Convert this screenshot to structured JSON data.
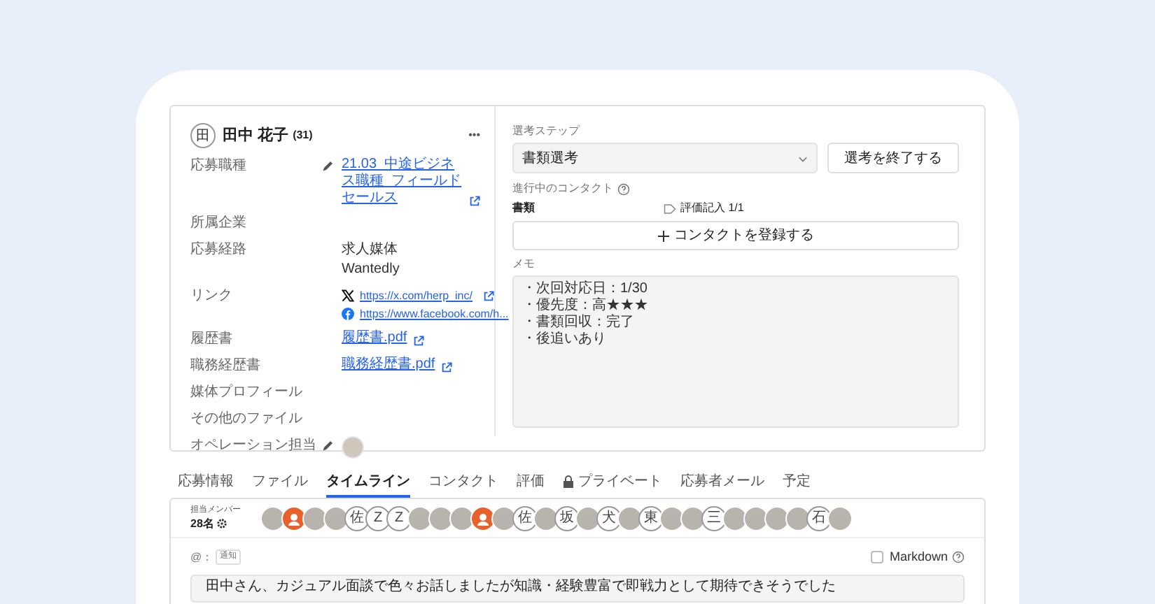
{
  "candidate": {
    "initial": "田",
    "name": "田中 花子",
    "age": "(31)",
    "more": "•••"
  },
  "fields": [
    {
      "label": "応募職種",
      "editable": true,
      "kind": "links",
      "values": [
        "21.03_中途ビジネス職種_フィールドセールス"
      ]
    },
    {
      "label": "所属企業",
      "editable": false,
      "kind": "text"
    },
    {
      "label": "応募経路",
      "editable": false,
      "kind": "text",
      "values": [
        "求人媒体",
        "Wantedly"
      ]
    },
    {
      "label": "リンク",
      "editable": false,
      "kind": "social",
      "values": [
        "https://x.com/herp_inc/",
        "https://www.facebook.com/h..."
      ]
    },
    {
      "label": "履歴書",
      "editable": false,
      "kind": "links",
      "values": [
        "履歴書.pdf"
      ]
    },
    {
      "label": "職務経歴書",
      "editable": false,
      "kind": "links",
      "values": [
        "職務経歴書.pdf"
      ]
    },
    {
      "label": "媒体プロフィール",
      "editable": false,
      "kind": "text"
    },
    {
      "label": "その他のファイル",
      "editable": false,
      "kind": "text"
    },
    {
      "label": "オペレーション担当",
      "editable": true,
      "kind": "avatar"
    }
  ],
  "step": {
    "label": "選考ステップ",
    "value": "書類選考",
    "end_button": "選考を終了する"
  },
  "contacts": {
    "label": "進行中のコンタクト",
    "name": "書類",
    "evaluation": "評価記入 1/1",
    "add_button": "コンタクトを登録する"
  },
  "memo": {
    "label": "メモ",
    "lines": [
      "・次回対応日：1/30",
      "・優先度：高★★★",
      "・書類回収：完了",
      "・後追いあり"
    ]
  },
  "tabs": [
    {
      "label": "応募情報",
      "selected": false,
      "locked": false
    },
    {
      "label": "ファイル",
      "selected": false,
      "locked": false
    },
    {
      "label": "タイムライン",
      "selected": true,
      "locked": false
    },
    {
      "label": "コンタクト",
      "selected": false,
      "locked": false
    },
    {
      "label": "評価",
      "selected": false,
      "locked": false
    },
    {
      "label": "プライベート",
      "selected": false,
      "locked": true
    },
    {
      "label": "応募者メール",
      "selected": false,
      "locked": false
    },
    {
      "label": "予定",
      "selected": false,
      "locked": false
    }
  ],
  "members": {
    "label": "担当メンバー",
    "count": "28名",
    "avatars": [
      {
        "kind": "photo"
      },
      {
        "kind": "generic"
      },
      {
        "kind": "photo"
      },
      {
        "kind": "photo"
      },
      {
        "kind": "initial",
        "text": "佐"
      },
      {
        "kind": "initial",
        "text": "Z"
      },
      {
        "kind": "initial",
        "text": "Z"
      },
      {
        "kind": "photo"
      },
      {
        "kind": "photo"
      },
      {
        "kind": "photo"
      },
      {
        "kind": "generic"
      },
      {
        "kind": "photo"
      },
      {
        "kind": "initial",
        "text": "佐"
      },
      {
        "kind": "photo"
      },
      {
        "kind": "initial",
        "text": "坂"
      },
      {
        "kind": "photo"
      },
      {
        "kind": "initial",
        "text": "犬"
      },
      {
        "kind": "photo"
      },
      {
        "kind": "initial",
        "text": "東"
      },
      {
        "kind": "photo"
      },
      {
        "kind": "photo"
      },
      {
        "kind": "initial",
        "text": "三"
      },
      {
        "kind": "photo"
      },
      {
        "kind": "photo"
      },
      {
        "kind": "photo"
      },
      {
        "kind": "photo"
      },
      {
        "kind": "initial",
        "text": "石"
      },
      {
        "kind": "photo"
      }
    ]
  },
  "composer": {
    "mention": "@：",
    "notify": "通知",
    "markdown": {
      "label": "Markdown",
      "checked": false
    },
    "value": "田中さん、カジュアル面談で色々お話しましたが知識・経験豊富で即戦力として期待できそうでした"
  }
}
